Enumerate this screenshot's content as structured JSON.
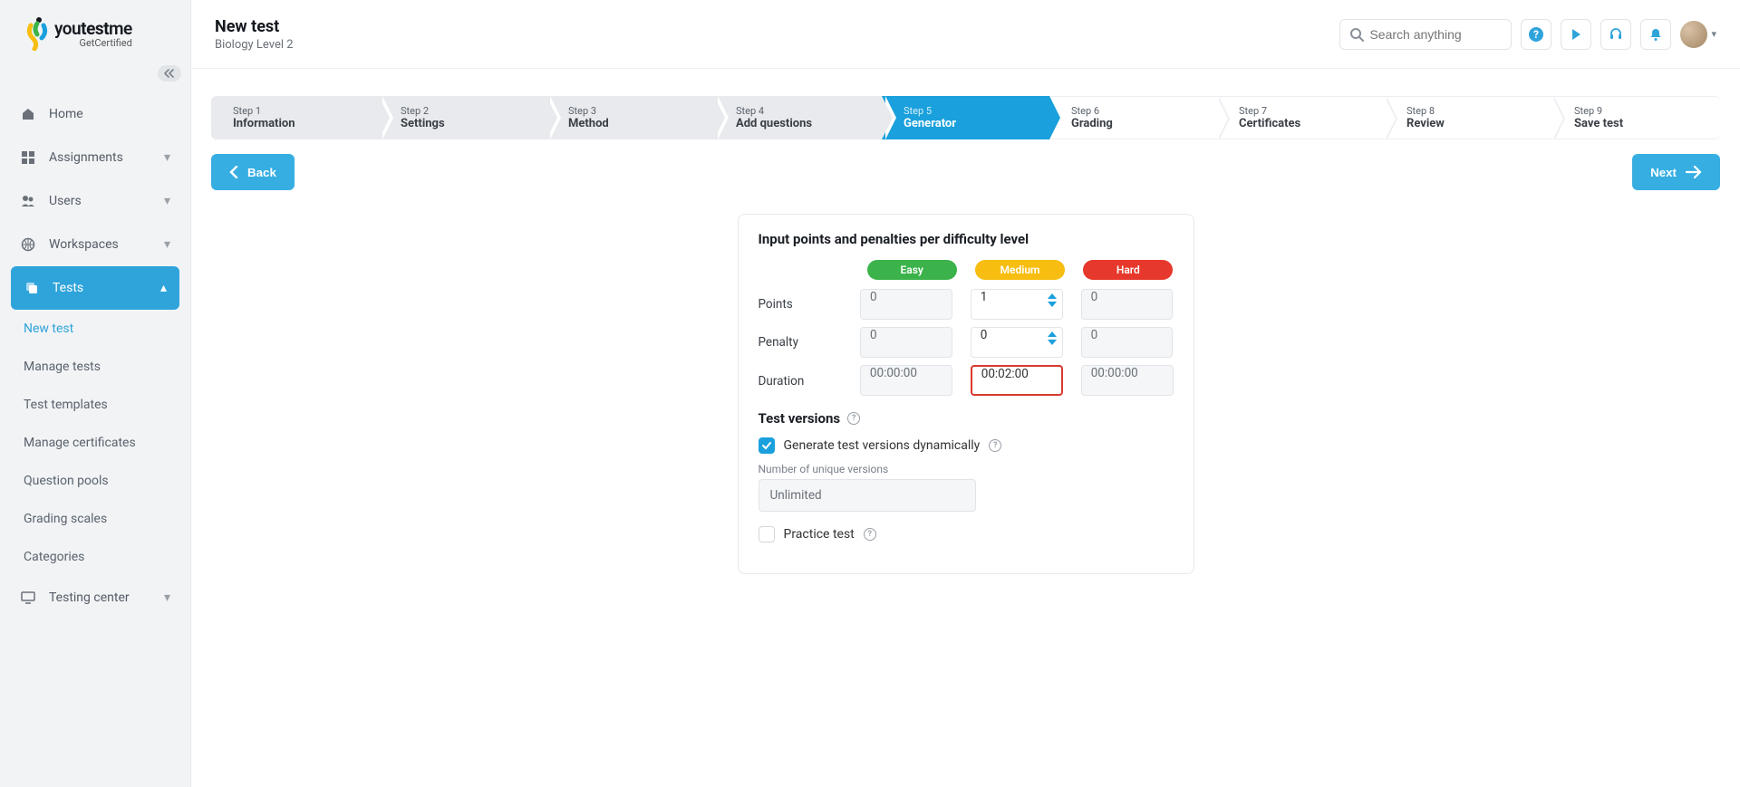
{
  "brand": {
    "you": "you",
    "test": "test",
    "me": "me",
    "sub": "GetCertified"
  },
  "sidebar": {
    "items": [
      {
        "label": "Home"
      },
      {
        "label": "Assignments"
      },
      {
        "label": "Users"
      },
      {
        "label": "Workspaces"
      },
      {
        "label": "Tests"
      },
      {
        "label": "Testing center"
      }
    ],
    "tests_sub": [
      {
        "label": "New test"
      },
      {
        "label": "Manage tests"
      },
      {
        "label": "Test templates"
      },
      {
        "label": "Manage certificates"
      },
      {
        "label": "Question pools"
      },
      {
        "label": "Grading scales"
      },
      {
        "label": "Categories"
      }
    ]
  },
  "header": {
    "title": "New test",
    "subtitle": "Biology Level 2"
  },
  "search": {
    "placeholder": "Search anything"
  },
  "steps": [
    {
      "no": "Step 1",
      "name": "Information"
    },
    {
      "no": "Step 2",
      "name": "Settings"
    },
    {
      "no": "Step 3",
      "name": "Method"
    },
    {
      "no": "Step 4",
      "name": "Add questions"
    },
    {
      "no": "Step 5",
      "name": "Generator"
    },
    {
      "no": "Step 6",
      "name": "Grading"
    },
    {
      "no": "Step 7",
      "name": "Certificates"
    },
    {
      "no": "Step 8",
      "name": "Review"
    },
    {
      "no": "Step 9",
      "name": "Save test"
    }
  ],
  "nav": {
    "back": "Back",
    "next": "Next"
  },
  "card": {
    "heading": "Input points and penalties per difficulty level",
    "levels": {
      "easy": "Easy",
      "medium": "Medium",
      "hard": "Hard"
    },
    "rows": {
      "points": {
        "label": "Points",
        "easy": "0",
        "medium": "1",
        "hard": "0"
      },
      "penalty": {
        "label": "Penalty",
        "easy": "0",
        "medium": "0",
        "hard": "0"
      },
      "duration": {
        "label": "Duration",
        "easy": "00:00:00",
        "medium": "00:02:00",
        "hard": "00:00:00"
      }
    },
    "versions": {
      "heading": "Test versions",
      "dynamic_label": "Generate test versions dynamically",
      "unique_label": "Number of unique versions",
      "unique_value": "Unlimited",
      "practice_label": "Practice test"
    }
  }
}
